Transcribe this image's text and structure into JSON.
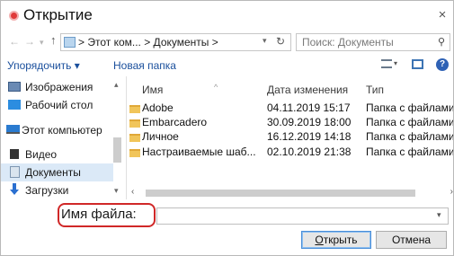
{
  "window": {
    "title": "Открытие",
    "close_glyph": "×",
    "title_icon": "red-circle-icon"
  },
  "navigation": {
    "back_glyph": "←",
    "forward_glyph": "→",
    "recent_glyph": "▾",
    "up_glyph": "↑",
    "address_text": "> Этот ком... > Документы >",
    "address_drop_glyph": "▾",
    "refresh_glyph": "↻",
    "search_placeholder": "Поиск: Документы",
    "search_glyph": "⚲"
  },
  "toolbar": {
    "organize_label": "Упорядочить ▾",
    "new_folder_label": "Новая папка",
    "view_drop_glyph": "▾",
    "help_glyph": "?"
  },
  "sidebar": {
    "items": [
      {
        "label": "Изображения",
        "icon": "images-icon"
      },
      {
        "label": "Рабочий стол",
        "icon": "desktop-icon"
      },
      {
        "label": "Этот компьютер",
        "icon": "computer-icon"
      },
      {
        "label": "Видео",
        "icon": "video-icon"
      },
      {
        "label": "Документы",
        "icon": "documents-icon",
        "selected": true
      },
      {
        "label": "Загрузки",
        "icon": "downloads-icon"
      }
    ],
    "scroll_up_glyph": "▴",
    "scroll_down_glyph": "▾"
  },
  "file_list": {
    "columns": [
      "Имя",
      "Дата изменения",
      "Тип"
    ],
    "sort_glyph": "^",
    "rows": [
      {
        "name": "Adobe",
        "date": "04.11.2019 15:17",
        "type": "Папка с файлами"
      },
      {
        "name": "Embarcadero",
        "date": "30.09.2019 18:00",
        "type": "Папка с файлами"
      },
      {
        "name": "Личное",
        "date": "16.12.2019 14:18",
        "type": "Папка с файлами"
      },
      {
        "name": "Настраиваемые шаб...",
        "date": "02.10.2019 21:38",
        "type": "Папка с файлами"
      }
    ],
    "hscroll_left_glyph": "‹",
    "hscroll_right_glyph": "›"
  },
  "footer": {
    "filename_label": "Имя файла:",
    "filename_value": "",
    "filename_drop_glyph": "▾",
    "open_label_accel": "О",
    "open_label_rest": "ткрыть",
    "cancel_label": "Отмена"
  },
  "colors": {
    "link_blue": "#1a4f9c",
    "selection": "#dbe9f7",
    "highlight_red": "#d02828",
    "folder_yellow": "#f1c55a"
  }
}
